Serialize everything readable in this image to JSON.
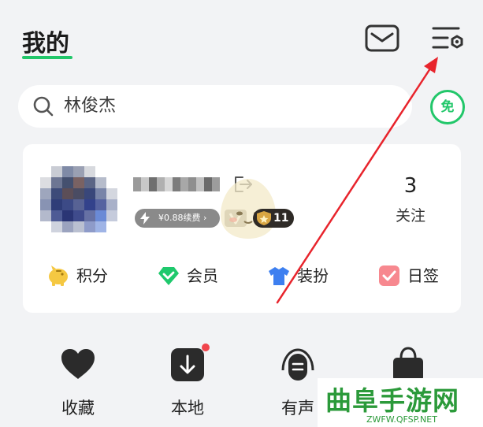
{
  "header": {
    "title": "我的"
  },
  "search": {
    "text": "林俊杰"
  },
  "free_badge": {
    "label": "免"
  },
  "profile": {
    "vip_price": "¥0.88续费 ›",
    "level": "11",
    "follow_count": "3",
    "follow_label": "关注"
  },
  "quick_actions": [
    {
      "label": "积分",
      "icon": "piggy-bank-icon"
    },
    {
      "label": "会员",
      "icon": "diamond-icon"
    },
    {
      "label": "装扮",
      "icon": "tshirt-icon"
    },
    {
      "label": "日签",
      "icon": "checkbox-icon"
    }
  ],
  "bottom_nav": [
    {
      "label": "收藏",
      "icon": "heart-icon"
    },
    {
      "label": "本地",
      "icon": "download-icon"
    },
    {
      "label": "有声",
      "icon": "podcast-icon"
    },
    {
      "label": "",
      "icon": "shopping-bag-icon"
    }
  ],
  "watermark": {
    "text": "曲阜手游网",
    "url": "ZWFW.QFSP.NET"
  },
  "colors": {
    "accent": "#22c76a",
    "background": "#f2f3f5",
    "annotation": "#e8242c",
    "badge_dark": "#2e2a26"
  }
}
